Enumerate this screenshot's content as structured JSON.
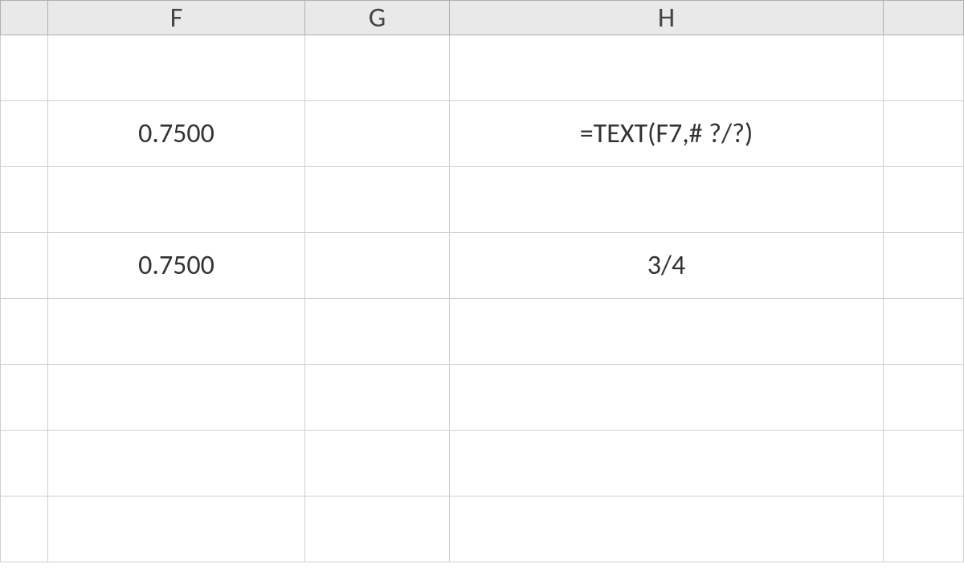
{
  "columns": {
    "E": "",
    "F": "F",
    "G": "G",
    "H": "H",
    "I": ""
  },
  "cells": {
    "F_row2": "0.7500",
    "H_row2": "=TEXT(F7,# ?/?)",
    "F_row4": "0.7500",
    "H_row4": "3/4"
  }
}
